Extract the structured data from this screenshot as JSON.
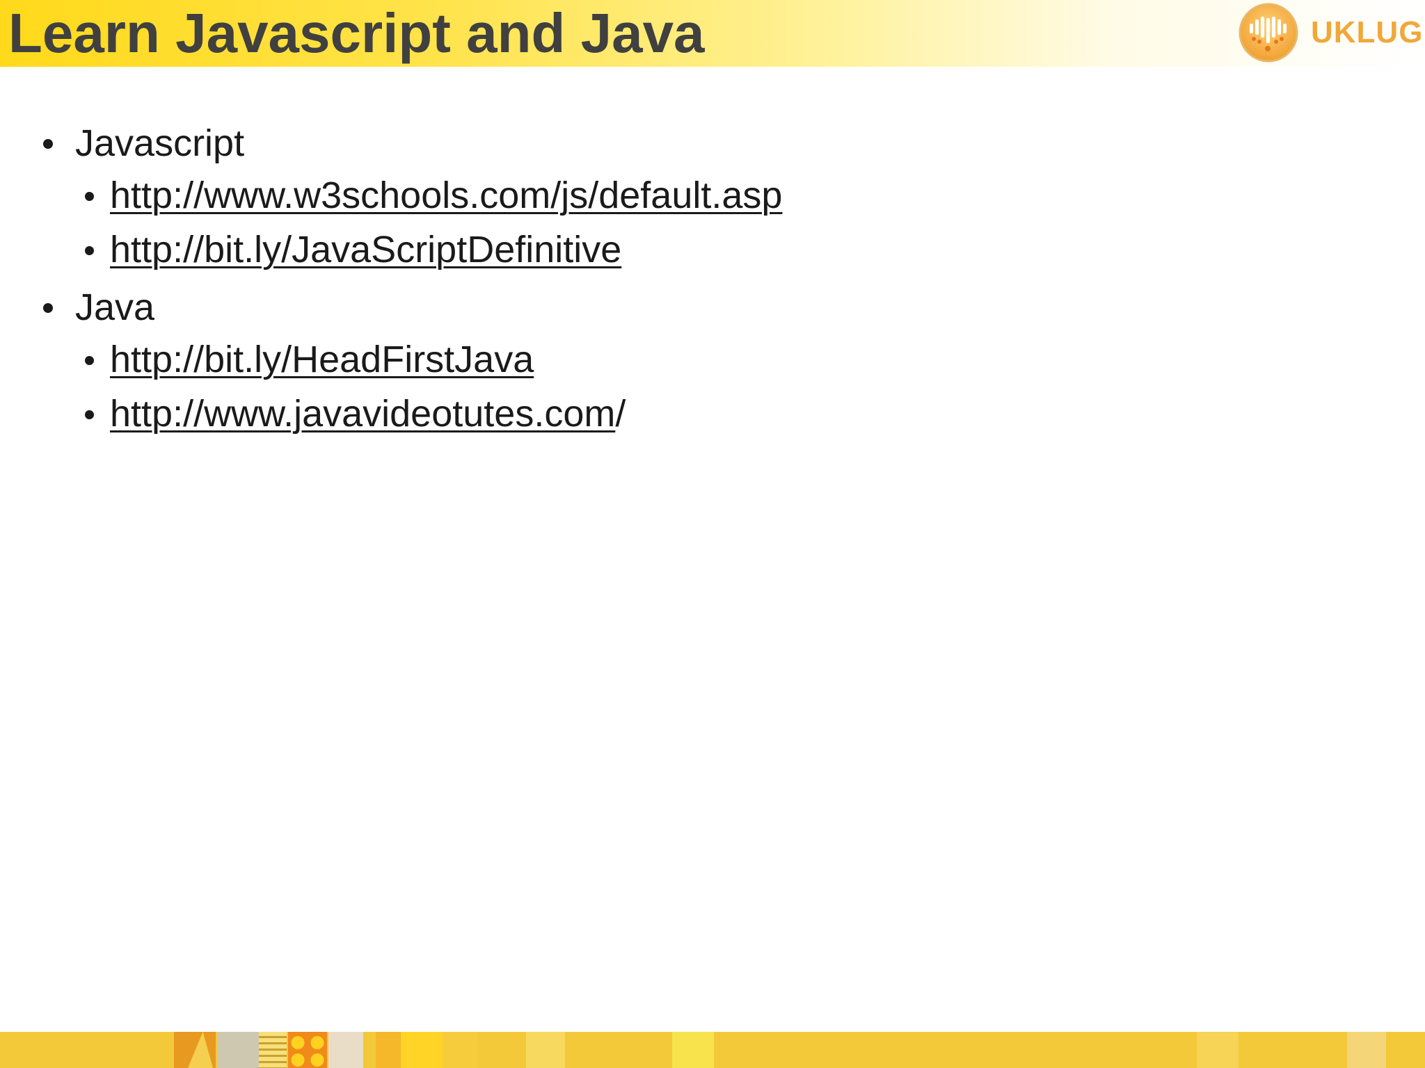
{
  "slide": {
    "title": "Learn Javascript and Java"
  },
  "logo": {
    "text": "UKLUG",
    "icon": "uklug-emblem-icon",
    "color": "#f0a838"
  },
  "sections": [
    {
      "label": "Javascript",
      "links": [
        {
          "text": "http://www.w3schools.com/js/default.asp",
          "trail": ""
        },
        {
          "text": "http://bit.ly/JavaScriptDefinitive",
          "trail": ""
        }
      ]
    },
    {
      "label": "Java",
      "links": [
        {
          "text": "http://bit.ly/HeadFirstJava",
          "trail": ""
        },
        {
          "text": "http://www.javavideotutes.com",
          "trail": "/"
        }
      ]
    }
  ],
  "colors": {
    "title_bar": "#ffd91a",
    "title_text": "#404040",
    "footer": "#f3c93a"
  }
}
